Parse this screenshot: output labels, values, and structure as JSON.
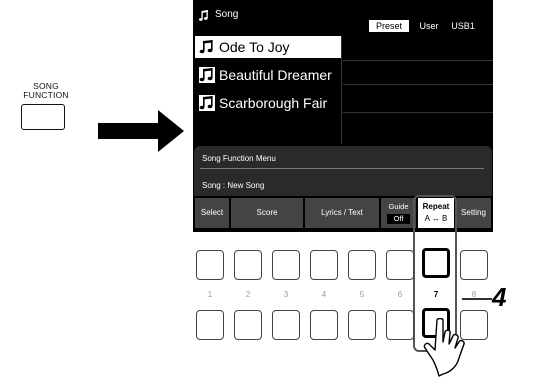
{
  "panel": {
    "song_function_label_line1": "SONG",
    "song_function_label_line2": "FUNCTION"
  },
  "screen": {
    "header_title": "Song",
    "tabs": [
      "Preset",
      "User",
      "USB1"
    ],
    "songs": [
      {
        "name": "Ode To Joy",
        "selected": true
      },
      {
        "name": "Beautiful Dreamer",
        "selected": false
      },
      {
        "name": "Scarborough Fair",
        "selected": false
      }
    ],
    "menu_title": "Song Function Menu",
    "song_line": "Song :  New Song",
    "buttons": {
      "select": "Select",
      "score": "Score",
      "lyrics_text": "Lyrics / Text",
      "guide": "Guide",
      "guide_value": "Off",
      "repeat": "Repeat",
      "repeat_ab": "A ↔ B",
      "setting": "Setting"
    }
  },
  "panel_buttons": {
    "numbers": [
      "1",
      "2",
      "3",
      "4",
      "5",
      "6",
      "7",
      "8"
    ]
  },
  "step": {
    "number": "4"
  }
}
